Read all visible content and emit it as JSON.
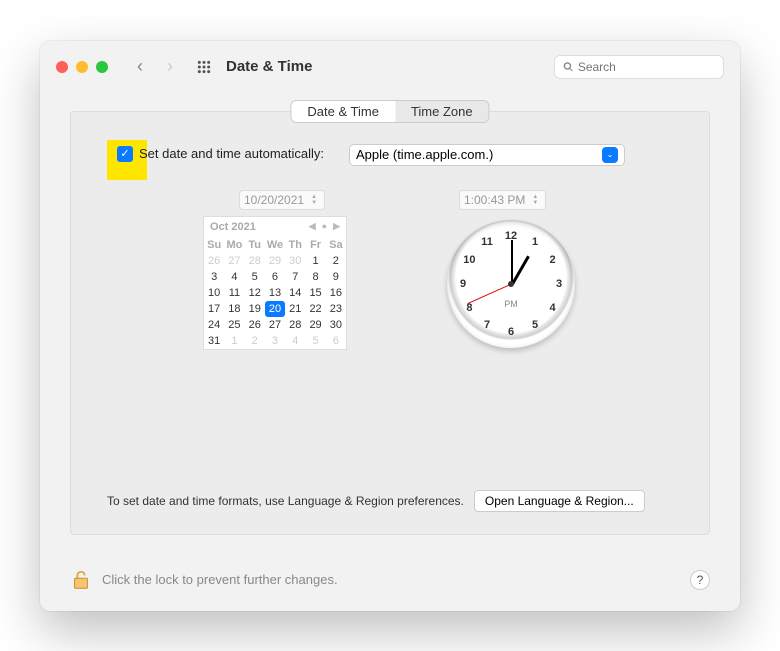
{
  "window": {
    "title": "Date & Time"
  },
  "search": {
    "placeholder": "Search"
  },
  "tabs": {
    "datetime": "Date & Time",
    "timezone": "Time Zone"
  },
  "auto": {
    "label": "Set date and time automatically:",
    "checked": true,
    "server": "Apple (time.apple.com.)"
  },
  "date_field": "10/20/2021",
  "time_field": "1:00:43 PM",
  "calendar": {
    "month_label": "Oct 2021",
    "dow": [
      "Su",
      "Mo",
      "Tu",
      "We",
      "Th",
      "Fr",
      "Sa"
    ],
    "days": [
      {
        "n": "26",
        "muted": true
      },
      {
        "n": "27",
        "muted": true
      },
      {
        "n": "28",
        "muted": true
      },
      {
        "n": "29",
        "muted": true
      },
      {
        "n": "30",
        "muted": true
      },
      {
        "n": "1"
      },
      {
        "n": "2"
      },
      {
        "n": "3"
      },
      {
        "n": "4"
      },
      {
        "n": "5"
      },
      {
        "n": "6"
      },
      {
        "n": "7"
      },
      {
        "n": "8"
      },
      {
        "n": "9"
      },
      {
        "n": "10"
      },
      {
        "n": "11"
      },
      {
        "n": "12"
      },
      {
        "n": "13"
      },
      {
        "n": "14"
      },
      {
        "n": "15"
      },
      {
        "n": "16"
      },
      {
        "n": "17"
      },
      {
        "n": "18"
      },
      {
        "n": "19"
      },
      {
        "n": "20",
        "sel": true
      },
      {
        "n": "21"
      },
      {
        "n": "22"
      },
      {
        "n": "23"
      },
      {
        "n": "24"
      },
      {
        "n": "25"
      },
      {
        "n": "26"
      },
      {
        "n": "27"
      },
      {
        "n": "28"
      },
      {
        "n": "29"
      },
      {
        "n": "30"
      },
      {
        "n": "31"
      },
      {
        "n": "1",
        "muted": true
      },
      {
        "n": "2",
        "muted": true
      },
      {
        "n": "3",
        "muted": true
      },
      {
        "n": "4",
        "muted": true
      },
      {
        "n": "5",
        "muted": true
      },
      {
        "n": "6",
        "muted": true
      }
    ]
  },
  "clock": {
    "ampm": "PM",
    "numbers": [
      "12",
      "1",
      "2",
      "3",
      "4",
      "5",
      "6",
      "7",
      "8",
      "9",
      "10",
      "11"
    ]
  },
  "hint": "To set date and time formats, use Language & Region preferences.",
  "open_btn": "Open Language & Region...",
  "lock_text": "Click the lock to prevent further changes.",
  "help": "?"
}
